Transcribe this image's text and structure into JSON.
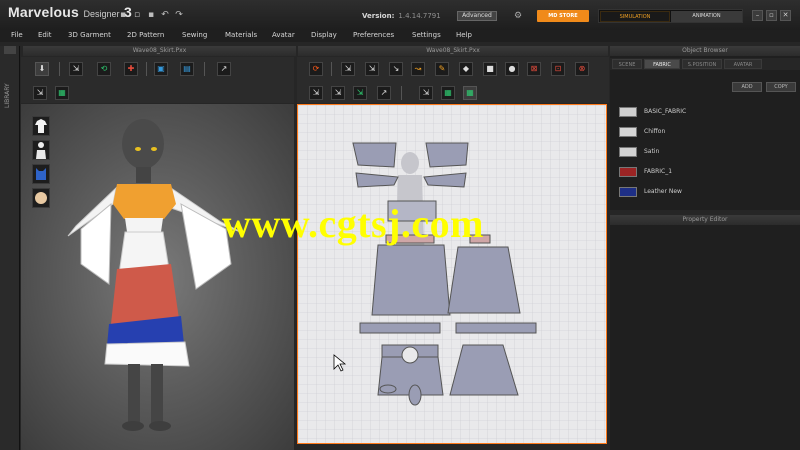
{
  "app": {
    "logo_main": "Marvelous",
    "logo_sub": "Designer",
    "logo_num": "3"
  },
  "titlebar": {
    "version_label": "Version:",
    "version_number": "1.4.14.7791",
    "edition_badge": "Advanced",
    "store_button": "MD STORE",
    "mode_simulation": "SIMULATION",
    "mode_animation": "ANIMATION",
    "minimize": "–",
    "restore": "▫",
    "close": "✕",
    "undo": "↶",
    "redo": "↷"
  },
  "menu": [
    "File",
    "Edit",
    "3D Garment",
    "2D Pattern",
    "Sewing",
    "Materials",
    "Avatar",
    "Display",
    "Preferences",
    "Settings",
    "Help"
  ],
  "panels": {
    "left_title": "Wave08_Skirt.Pxx",
    "middle_title": "Wave08_Skirt.Pxx",
    "right_title": "Object Browser",
    "library_label": "LIBRARY",
    "property_editor_title": "Property Editor"
  },
  "object_browser": {
    "tabs": [
      "SCENE",
      "FABRIC",
      "S.POSITION",
      "AVATAR"
    ],
    "active_tab": "FABRIC",
    "add_button": "ADD",
    "copy_button": "COPY",
    "fabrics": [
      {
        "name": "BASIC_FABRIC",
        "color": "#cfcfcf"
      },
      {
        "name": "Chiffon",
        "color": "#d6d6d6"
      },
      {
        "name": "Satin",
        "color": "#d2d2d2"
      },
      {
        "name": "FABRIC_1",
        "color": "#9b2424"
      },
      {
        "name": "Leather New",
        "color": "#1e2f86"
      }
    ]
  },
  "watermark": "www.cgtsj.com",
  "colors": {
    "accent_orange": "#f08a1a",
    "simulation_text": "#f0a022",
    "pattern_fill": "#9a9db4",
    "viewport_border": "#ff7a1a",
    "watermark": "#ffff00"
  },
  "icons": {
    "viewport_buttons": [
      "garment-shirt-icon",
      "avatar-body-icon",
      "fabric-blue-icon",
      "avatar-head-icon"
    ]
  }
}
